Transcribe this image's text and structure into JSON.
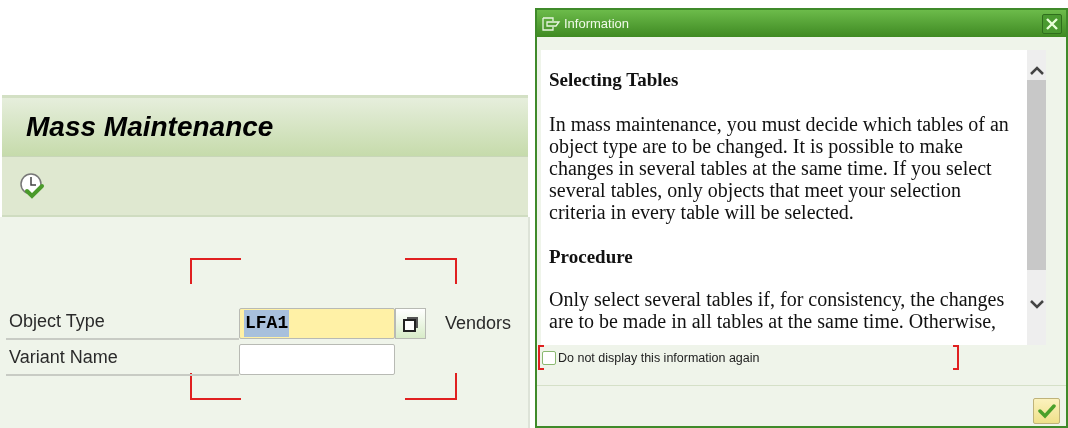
{
  "main": {
    "title": "Mass Maintenance",
    "fields": [
      {
        "label": "Object Type",
        "kind": "required",
        "value": "LFA1",
        "value_selected": true,
        "description": "Vendors"
      },
      {
        "label": "Variant Name",
        "kind": "plain"
      }
    ]
  },
  "dialog": {
    "title": "Information",
    "sections": [
      {
        "heading": "Selecting Tables",
        "text": "In mass maintenance, you must decide which tables of an object type are to be changed. It is possible to make changes in several tables at the same time. If you select several tables, only objects that meet your selection criteria in every table will be selected."
      },
      {
        "heading": "Procedure",
        "text": "Only select several tables if, for consistency, the changes are to be made in all tables at the same time. Otherwise,"
      }
    ],
    "checkbox": {
      "label": "Do not display this information again",
      "checked": false
    }
  }
}
